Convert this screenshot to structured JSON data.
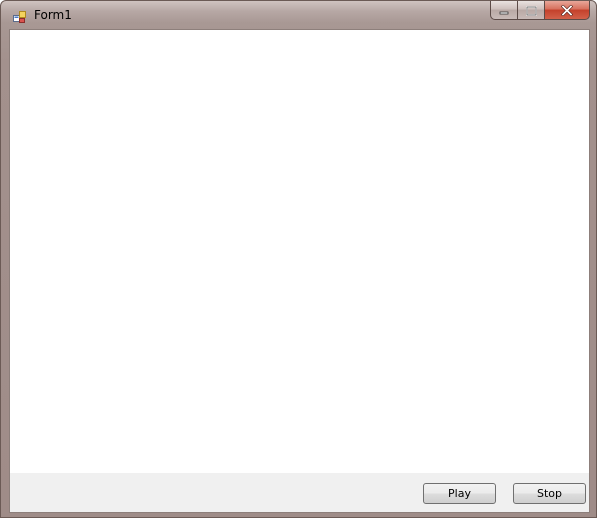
{
  "window": {
    "title": "Form1",
    "icon": "winforms-app-icon"
  },
  "caption": {
    "minimize_icon": "minimize-icon",
    "maximize_icon": "maximize-icon",
    "close_icon": "close-icon"
  },
  "buttons": {
    "play_label": "Play",
    "stop_label": "Stop"
  },
  "colors": {
    "close_button": "#c4412b",
    "client_background": "#f0f0f0",
    "panel_background": "#ffffff"
  }
}
